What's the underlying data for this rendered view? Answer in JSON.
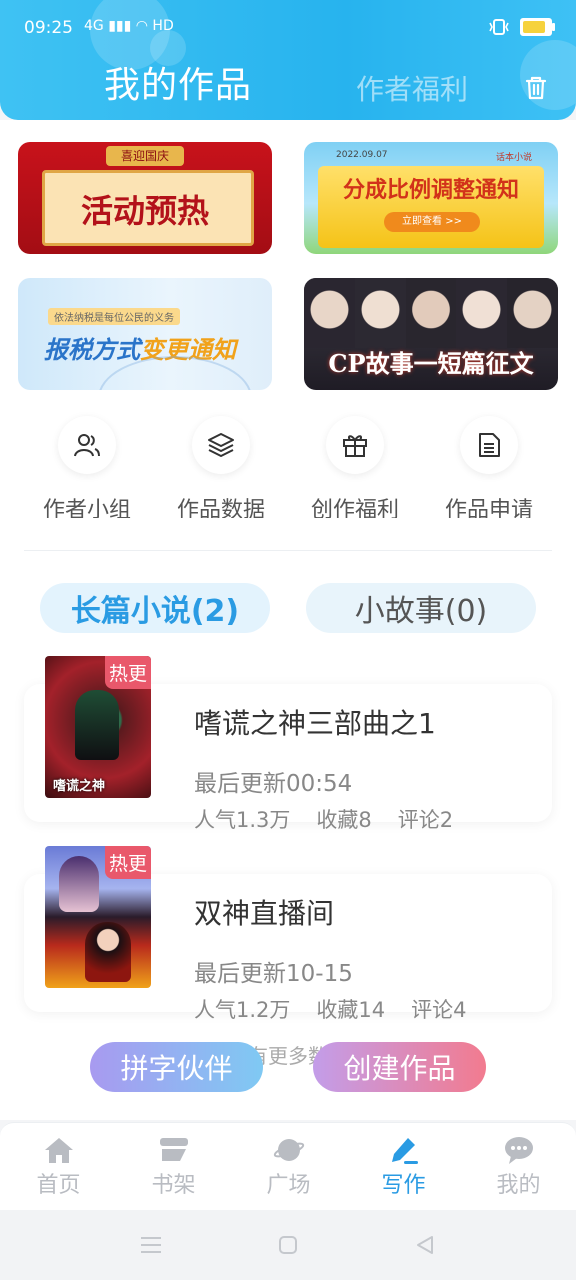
{
  "status_bar": {
    "time": "09:25",
    "signal": "4G ▮▮▮ ◠ HD"
  },
  "header": {
    "tab_active": "我的作品",
    "tab_inactive": "作者福利"
  },
  "banners": [
    {
      "badge": "喜迎国庆",
      "text": "活动预热"
    },
    {
      "date": "2022.09.07",
      "tag": "话本小说",
      "text": "分成比例调整通知",
      "button": "立即查看 >>"
    },
    {
      "small": "依法纳税是每位公民的义务",
      "text_a": "报税方式",
      "text_b": "变更通知"
    },
    {
      "text": "CP故事一短篇征文"
    }
  ],
  "shortcuts": [
    {
      "label": "作者小组",
      "icon": "users-icon"
    },
    {
      "label": "作品数据",
      "icon": "layers-icon"
    },
    {
      "label": "创作福利",
      "icon": "gift-icon"
    },
    {
      "label": "作品申请",
      "icon": "document-icon"
    }
  ],
  "segments": {
    "long": "长篇小说(2)",
    "short": "小故事(0)"
  },
  "works": [
    {
      "title": "嗜谎之神三部曲之1",
      "badge": "热更",
      "cover_text": "嗜谎之神",
      "updated": "最后更新00:54",
      "popularity": "人气1.3万",
      "favorites": "收藏8",
      "comments": "评论2"
    },
    {
      "title": "双神直播间",
      "badge": "热更",
      "updated": "最后更新10-15",
      "popularity": "人气1.2万",
      "favorites": "收藏14",
      "comments": "评论4"
    }
  ],
  "no_more": "没有更多数据",
  "fab": {
    "partner": "拼字伙伴",
    "create": "创建作品"
  },
  "tabbar": [
    {
      "label": "首页",
      "icon": "home-icon"
    },
    {
      "label": "书架",
      "icon": "bookshelf-icon"
    },
    {
      "label": "广场",
      "icon": "planet-icon"
    },
    {
      "label": "写作",
      "icon": "pen-icon",
      "active": true
    },
    {
      "label": "我的",
      "icon": "chat-bubble-icon"
    }
  ],
  "colors": {
    "accent": "#2a9be3",
    "hot": "#e9586b"
  }
}
